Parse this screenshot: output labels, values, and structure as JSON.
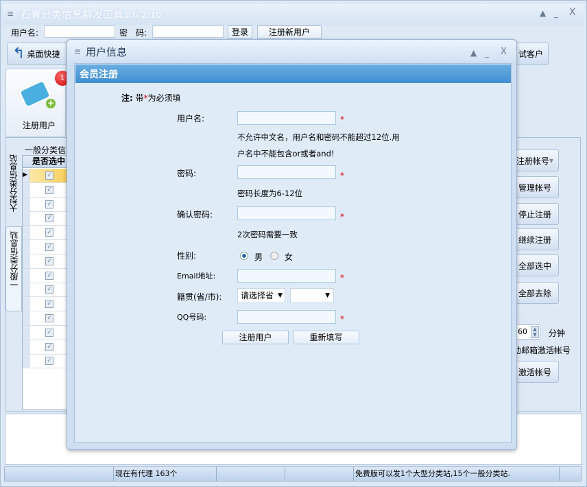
{
  "app": {
    "title": "石青分类信息群发工具",
    "version": "1.6.2.10"
  },
  "login": {
    "username_label": "用户名:",
    "username_value": "",
    "password_label": "密　码:",
    "password_value": "",
    "login_button": "登录",
    "register_button": "注册新用户"
  },
  "toolbar": {
    "desktop_shortcut": "桌面快捷",
    "test_customer": "试客户"
  },
  "big_button": {
    "label": "注册用户",
    "badge": "1"
  },
  "vertical_tabs": [
    "大型分类信息站",
    "一般分类信息站"
  ],
  "grid": {
    "group_title": "一般分类信息",
    "column_header": "是否选中",
    "rows": [
      true,
      true,
      true,
      true,
      true,
      true,
      true,
      true,
      true,
      true,
      true,
      true,
      true,
      true
    ],
    "selected_row": 0
  },
  "right_panel": {
    "buttons": [
      "注册帐号",
      "管理帐号",
      "停止注册",
      "继续注册",
      "全部选中",
      "全部去除"
    ],
    "interval_value": "60",
    "interval_unit": "分钟",
    "auto_activate_label": "动邮箱激活帐号",
    "activate_button": "激活帐号"
  },
  "status_bar": {
    "proxy_count": "现在有代理 163个",
    "free_notice": "免费版可以发1个大型分类站,15个一般分类站."
  },
  "dialog": {
    "title": "用户信息",
    "section_title": "会员注册",
    "required_note_prefix": "注:",
    "required_note_text_a": "带",
    "required_note_star": "*",
    "required_note_text_b": "为必须填",
    "fields": {
      "username": {
        "label": "用户名:",
        "value": "",
        "hint_line1": "不允许中文名，用户名和密码不能超过12位.用",
        "hint_line2": "户名中不能包含or或者and!"
      },
      "password": {
        "label": "密码:",
        "value": "",
        "hint": "密码长度为6-12位"
      },
      "confirm_password": {
        "label": "确认密码:",
        "value": "",
        "hint": "2次密码需要一致"
      },
      "gender": {
        "label": "性别:",
        "options": [
          "男",
          "女"
        ],
        "selected": "男"
      },
      "email": {
        "label": "Email地址:",
        "value": ""
      },
      "hometown": {
        "label": "籍贯(省/市):",
        "province": "请选择省",
        "city": ""
      },
      "qq": {
        "label": "QQ号码:",
        "value": ""
      }
    },
    "submit_button": "注册用户",
    "reset_button": "重新填写"
  },
  "colors": {
    "accent": "#3f8fd0",
    "required": "#dd0000",
    "window_bg": "#dfe9f6"
  }
}
